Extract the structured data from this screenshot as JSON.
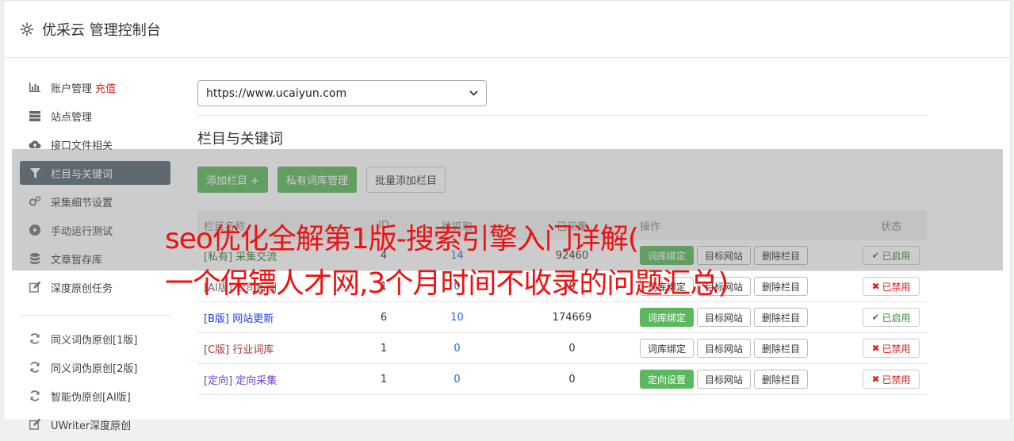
{
  "header": {
    "title": "优采云 管理控制台"
  },
  "sidebar": {
    "items": [
      {
        "label": "账户管理",
        "extra": "充值",
        "icon": "bar-chart-icon"
      },
      {
        "label": "站点管理",
        "icon": "server-icon"
      },
      {
        "label": "接口文件相关",
        "icon": "cloud-upload-icon"
      },
      {
        "label": "栏目与关键词",
        "icon": "filter-icon",
        "active": true
      },
      {
        "label": "采集细节设置",
        "icon": "cogs-icon"
      },
      {
        "label": "手动运行测试",
        "icon": "play-circle-icon"
      },
      {
        "label": "文章暂存库",
        "icon": "database-icon"
      },
      {
        "label": "深度原创任务",
        "icon": "edit-icon"
      }
    ],
    "items2": [
      {
        "label": "同义词伪原创[1版]",
        "icon": "refresh-icon"
      },
      {
        "label": "同义词伪原创[2版]",
        "icon": "refresh-icon"
      },
      {
        "label": "智能伪原创[AI版]",
        "icon": "refresh-icon"
      },
      {
        "label": "UWriter深度原创",
        "icon": "edit-icon"
      }
    ]
  },
  "site_select": {
    "value": "https://www.ucaiyun.com"
  },
  "section": {
    "title": "栏目与关键词"
  },
  "toolbar": {
    "add": "添加栏目 +",
    "private": "私有词库管理",
    "batch": "批量添加栏目"
  },
  "table": {
    "headers": [
      "栏目名称",
      "ID",
      "待抓取",
      "已采集",
      "操作",
      "状态"
    ],
    "rows": [
      {
        "tag": "[私有]",
        "name": "采集交流",
        "id": "4",
        "pending": "14",
        "collected": "92460",
        "btn1": "词库绑定",
        "btn2": "目标网站",
        "btn3": "删除栏目",
        "status": "已启用"
      },
      {
        "tag": "[AI版]",
        "name": "公司新闻",
        "id": "1",
        "pending": "0",
        "collected": "0",
        "btn1": "词库绑定",
        "btn2": "目标网站",
        "btn3": "删除栏目",
        "status": "已禁用"
      },
      {
        "tag": "[B版]",
        "name": "网站更新",
        "id": "6",
        "pending": "10",
        "collected": "174669",
        "btn1": "词库绑定",
        "btn2": "目标网站",
        "btn3": "删除栏目",
        "status": "已启用"
      },
      {
        "tag": "[C版]",
        "name": "行业词库",
        "id": "1",
        "pending": "0",
        "collected": "0",
        "btn1": "词库绑定",
        "btn2": "目标网站",
        "btn3": "删除栏目",
        "status": "已禁用"
      },
      {
        "tag": "[定向]",
        "name": "定向采集",
        "id": "1",
        "pending": "0",
        "collected": "0",
        "btn1": "定向设置",
        "btn2": "目标网站",
        "btn3": "删除栏目",
        "status": "已禁用"
      }
    ]
  },
  "watermark": {
    "line1": "seo优化全解第1版-搜索引擎入门详解(",
    "line2": "一个保镖人才网,3个月时间不收录的问题汇总)"
  }
}
